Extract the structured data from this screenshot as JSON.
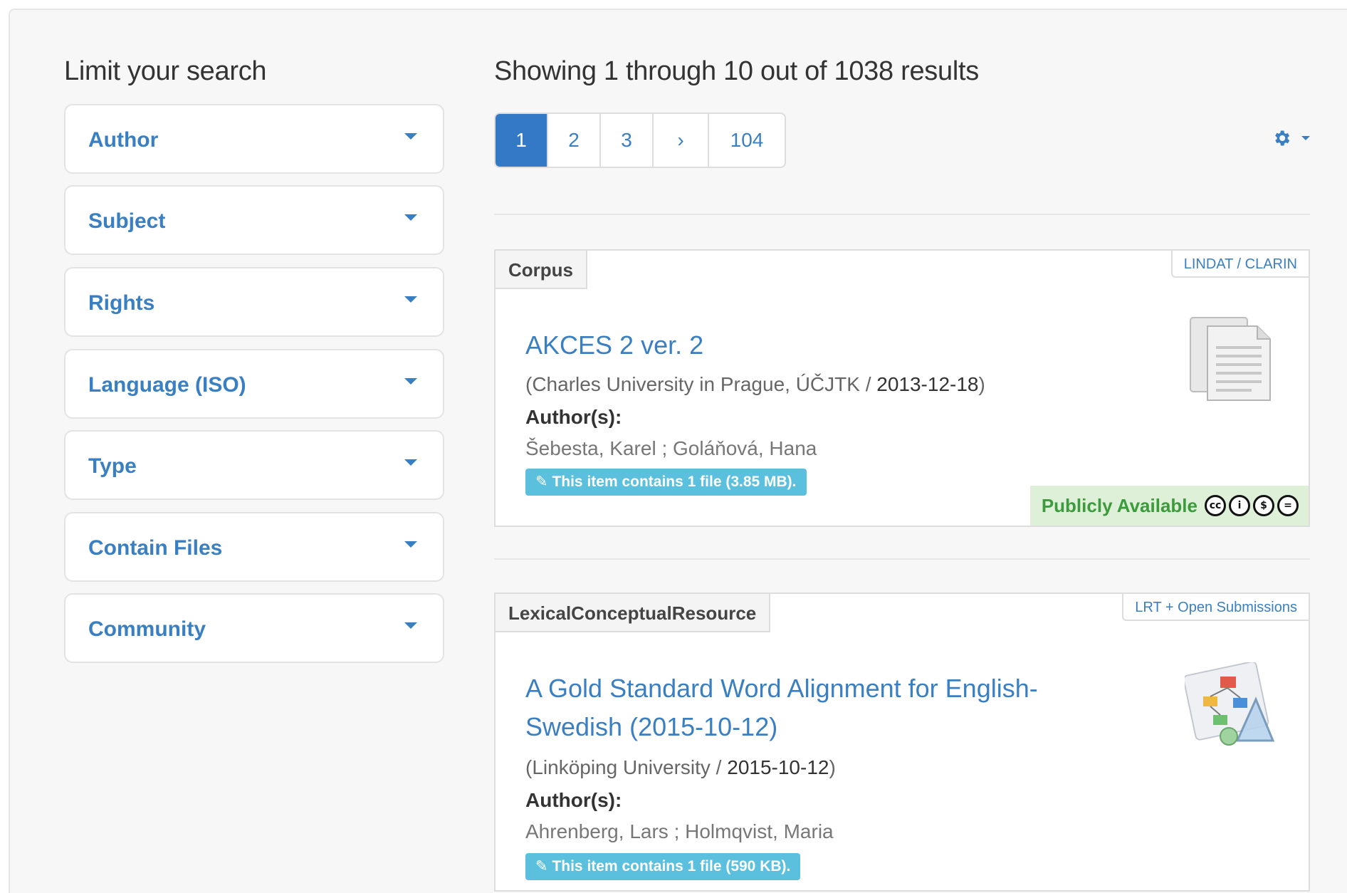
{
  "sidebar": {
    "heading": "Limit your search",
    "facets": [
      {
        "label": "Author"
      },
      {
        "label": "Subject"
      },
      {
        "label": "Rights"
      },
      {
        "label": "Language (ISO)"
      },
      {
        "label": "Type"
      },
      {
        "label": "Contain Files"
      },
      {
        "label": "Community"
      }
    ]
  },
  "main": {
    "results_heading": "Showing 1 through 10 out of 1038 results",
    "pagination": {
      "pages": [
        "1",
        "2",
        "3",
        "›",
        "104"
      ],
      "active": "1"
    },
    "settings_icon": "gear-icon"
  },
  "items": [
    {
      "type": "Corpus",
      "collection": "LINDAT / CLARIN",
      "title": "AKCES 2 ver. 2",
      "publisher": "Charles University in Prague, ÚČJTK",
      "date": "2013-12-18",
      "authors_label": "Author(s):",
      "authors": "Šebesta, Karel ; Goláňová, Hana",
      "files": "This item contains 1 file (3.85 MB).",
      "availability": "Publicly Available",
      "thumbnail": "document-icon"
    },
    {
      "type": "LexicalConceptualResource",
      "collection": "LRT + Open Submissions",
      "title": "A Gold Standard Word Alignment for English-Swedish (2015-10-12)",
      "publisher": "Linköping University",
      "date": "2015-10-12",
      "authors_label": "Author(s):",
      "authors": "Ahrenberg, Lars ; Holmqvist, Maria",
      "files": "This item contains 1 file (590 KB).",
      "thumbnail": "diagram-icon"
    }
  ],
  "colors": {
    "link": "#3a7fc1",
    "active_page": "#3479c5",
    "files_badge": "#5bc0de",
    "available_bg": "#dff0d8",
    "available_text": "#3c9b3c"
  }
}
